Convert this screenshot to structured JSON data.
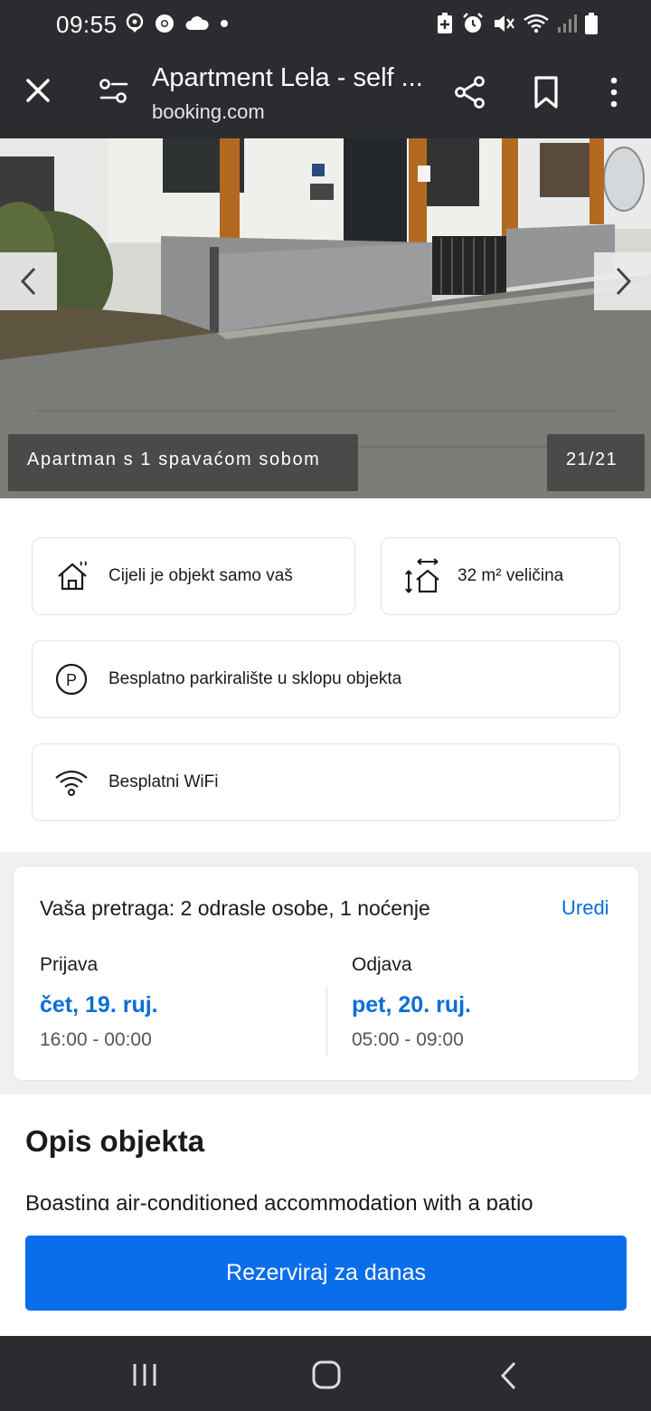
{
  "status_bar": {
    "time": "09:55",
    "left_icons": [
      "location-icon",
      "chrome-icon",
      "cloud-icon",
      "dot-icon"
    ],
    "right_icons": [
      "battery-saver-icon",
      "alarm-icon",
      "mute-icon",
      "wifi-icon",
      "signal-icon",
      "battery-icon"
    ]
  },
  "tab_header": {
    "title": "Apartment Lela - self ...",
    "url": "booking.com"
  },
  "hero": {
    "caption": "Apartman s 1 spavaćom sobom",
    "counter": "21/21"
  },
  "facilities": [
    {
      "icon": "house-icon",
      "label": "Cijeli je objekt samo vaš"
    },
    {
      "icon": "size-icon",
      "label": "32 m² veličina"
    },
    {
      "icon": "parking-icon",
      "label": "Besplatno parkiralište u sklopu objekta"
    },
    {
      "icon": "wifi-icon",
      "label": "Besplatni WiFi"
    }
  ],
  "search": {
    "summary": "Vaša pretraga: 2 odrasle osobe, 1 noćenje",
    "edit_label": "Uredi",
    "checkin": {
      "label": "Prijava",
      "date": "čet, 19. ruj.",
      "time": "16:00 - 00:00"
    },
    "checkout": {
      "label": "Odjava",
      "date": "pet, 20. ruj.",
      "time": "05:00 - 09:00"
    }
  },
  "description": {
    "title": "Opis objekta",
    "text": "Boasting air-conditioned accommodation with a patio"
  },
  "reserve_button": "Rezerviraj za danas",
  "nav_bar": {
    "icons": [
      "recent-apps-icon",
      "home-icon",
      "back-icon"
    ]
  },
  "colors": {
    "chrome_dark": "#2b2c30",
    "accent_blue": "#0a6dd6",
    "button_blue": "#0a6dea"
  }
}
